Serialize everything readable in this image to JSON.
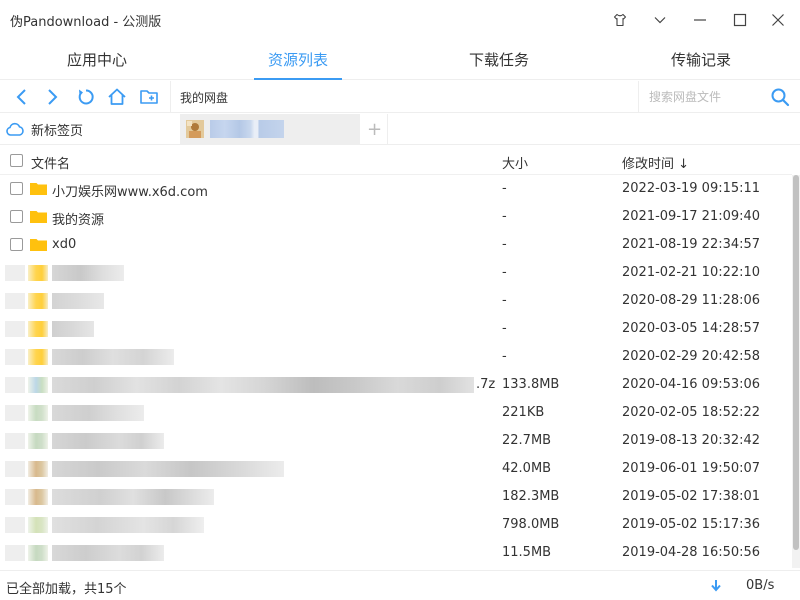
{
  "window": {
    "title": "伪Pandownload - 公测版"
  },
  "nav_tabs": [
    "应用中心",
    "资源列表",
    "下载任务",
    "传输记录"
  ],
  "toolbar": {
    "path": "我的网盘",
    "search_placeholder": "搜索网盘文件"
  },
  "page_tabs": {
    "first": "新标签页"
  },
  "columns": {
    "name": "文件名",
    "size": "大小",
    "modified": "修改时间 ↓"
  },
  "files": [
    {
      "name": "小刀娱乐网www.x6d.com",
      "size": "-",
      "modified": "2022-03-19 09:15:11"
    },
    {
      "name": "我的资源",
      "size": "-",
      "modified": "2021-09-17 21:09:40"
    },
    {
      "name": "xd0",
      "size": "-",
      "modified": "2021-08-19 22:34:57"
    },
    {
      "name": "",
      "size": "-",
      "modified": "2021-02-21 10:22:10"
    },
    {
      "name": "",
      "size": "-",
      "modified": "2020-08-29 11:28:06"
    },
    {
      "name": "",
      "size": "-",
      "modified": "2020-03-05 14:28:57"
    },
    {
      "name": "",
      "size": "-",
      "modified": "2020-02-29 20:42:58"
    },
    {
      "name": ".7z",
      "size": "133.8MB",
      "modified": "2020-04-16 09:53:06"
    },
    {
      "name": "",
      "size": "221KB",
      "modified": "2020-02-05 18:52:22"
    },
    {
      "name": "",
      "size": "22.7MB",
      "modified": "2019-08-13 20:32:42"
    },
    {
      "name": "",
      "size": "42.0MB",
      "modified": "2019-06-01 19:50:07"
    },
    {
      "name": "",
      "size": "182.3MB",
      "modified": "2019-05-02 17:38:01"
    },
    {
      "name": "",
      "size": "798.0MB",
      "modified": "2019-05-02 15:17:36"
    },
    {
      "name": "",
      "size": "11.5MB",
      "modified": "2019-04-28 16:50:56"
    }
  ],
  "status": {
    "text": "已全部加载，共15个",
    "speed": "0B/s"
  },
  "colors": {
    "accent": "#3b9bf3",
    "folder": "#ffc10e"
  }
}
